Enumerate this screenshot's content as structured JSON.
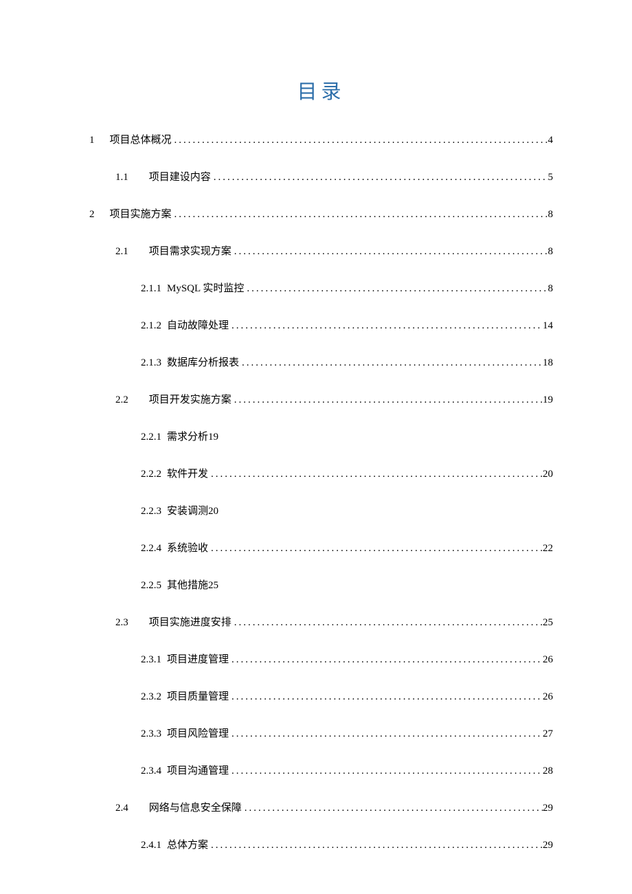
{
  "title": "目录",
  "entries": [
    {
      "level": 1,
      "number": "1",
      "text": "项目总体概况",
      "page": "4",
      "dots": true
    },
    {
      "level": 2,
      "number": "1.1",
      "text": "项目建设内容",
      "page": "5",
      "dots": true
    },
    {
      "level": 1,
      "number": "2",
      "text": "项目实施方案",
      "page": "8",
      "dots": true
    },
    {
      "level": 2,
      "number": "2.1",
      "text": "项目需求实现方案",
      "page": "8",
      "dots": true
    },
    {
      "level": 3,
      "number": "2.1.1",
      "text": "MySQL 实时监控",
      "page": "8",
      "dots": true
    },
    {
      "level": 3,
      "number": "2.1.2",
      "text": "自动故障处理",
      "page": "14",
      "dots": true
    },
    {
      "level": 3,
      "number": "2.1.3",
      "text": "数据库分析报表",
      "page": "18",
      "dots": true
    },
    {
      "level": 2,
      "number": "2.2",
      "text": "项目开发实施方案",
      "page": "19",
      "dots": true
    },
    {
      "level": 3,
      "number": "2.2.1",
      "text": "需求分析",
      "page": "19",
      "dots": false
    },
    {
      "level": 3,
      "number": "2.2.2",
      "text": "软件开发",
      "page": "20",
      "dots": true
    },
    {
      "level": 3,
      "number": "2.2.3",
      "text": "安装调测",
      "page": "20",
      "dots": false
    },
    {
      "level": 3,
      "number": "2.2.4",
      "text": "系统验收",
      "page": "22",
      "dots": true
    },
    {
      "level": 3,
      "number": "2.2.5",
      "text": "其他措施",
      "page": "25",
      "dots": false
    },
    {
      "level": 2,
      "number": "2.3",
      "text": "项目实施进度安排",
      "page": "25",
      "dots": true
    },
    {
      "level": 3,
      "number": "2.3.1",
      "text": "项目进度管理",
      "page": "26",
      "dots": true
    },
    {
      "level": 3,
      "number": "2.3.2",
      "text": "项目质量管理",
      "page": "26",
      "dots": true
    },
    {
      "level": 3,
      "number": "2.3.3",
      "text": "项目风险管理",
      "page": "27",
      "dots": true
    },
    {
      "level": 3,
      "number": "2.3.4",
      "text": "项目沟通管理",
      "page": "28",
      "dots": true
    },
    {
      "level": 2,
      "number": "2.4",
      "text": "网络与信息安全保障",
      "page": "29",
      "dots": true
    },
    {
      "level": 3,
      "number": "2.4.1",
      "text": "总体方案",
      "page": "29",
      "dots": true
    }
  ]
}
